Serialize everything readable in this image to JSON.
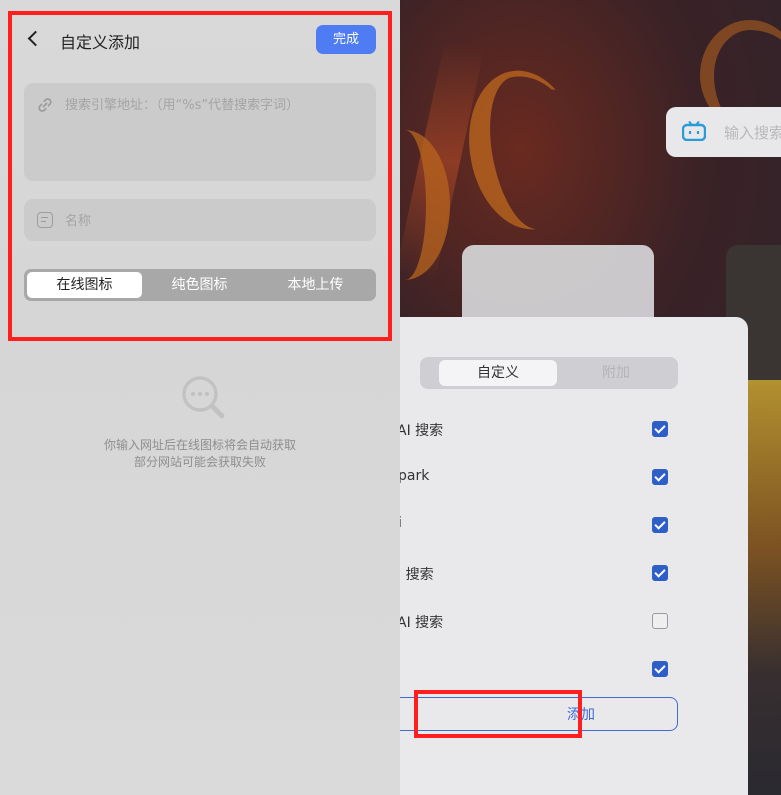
{
  "panel": {
    "title": "自定义添加",
    "done_label": "完成",
    "url_placeholder": "搜索引擎地址：（用“%s”代替搜索字词）",
    "name_placeholder": "名称",
    "icon_tabs": [
      {
        "label": "在线图标",
        "active": true
      },
      {
        "label": "纯色图标",
        "active": false
      },
      {
        "label": "本地上传",
        "active": false
      }
    ],
    "hint_lines": [
      "你输入网址后在线图标将会自动获取",
      "部分网站可能会获取失败"
    ]
  },
  "background": {
    "search_placeholder": "输入搜索",
    "segment": [
      {
        "label": "自定义",
        "selected": true
      },
      {
        "label": "附加",
        "selected": false
      }
    ],
    "rows": [
      {
        "label": "AI 搜索",
        "checked": true
      },
      {
        "label": "park",
        "checked": true
      },
      {
        "label": "i",
        "checked": true
      },
      {
        "label": "I 搜索",
        "checked": true
      },
      {
        "label": "AI 搜索",
        "checked": false
      },
      {
        "label": "",
        "checked": true
      }
    ],
    "add_label": "添加"
  },
  "colors": {
    "accent": "#4f7cf2",
    "highlight": "#ff1f1f",
    "checkbox": "#2e5fc9"
  }
}
